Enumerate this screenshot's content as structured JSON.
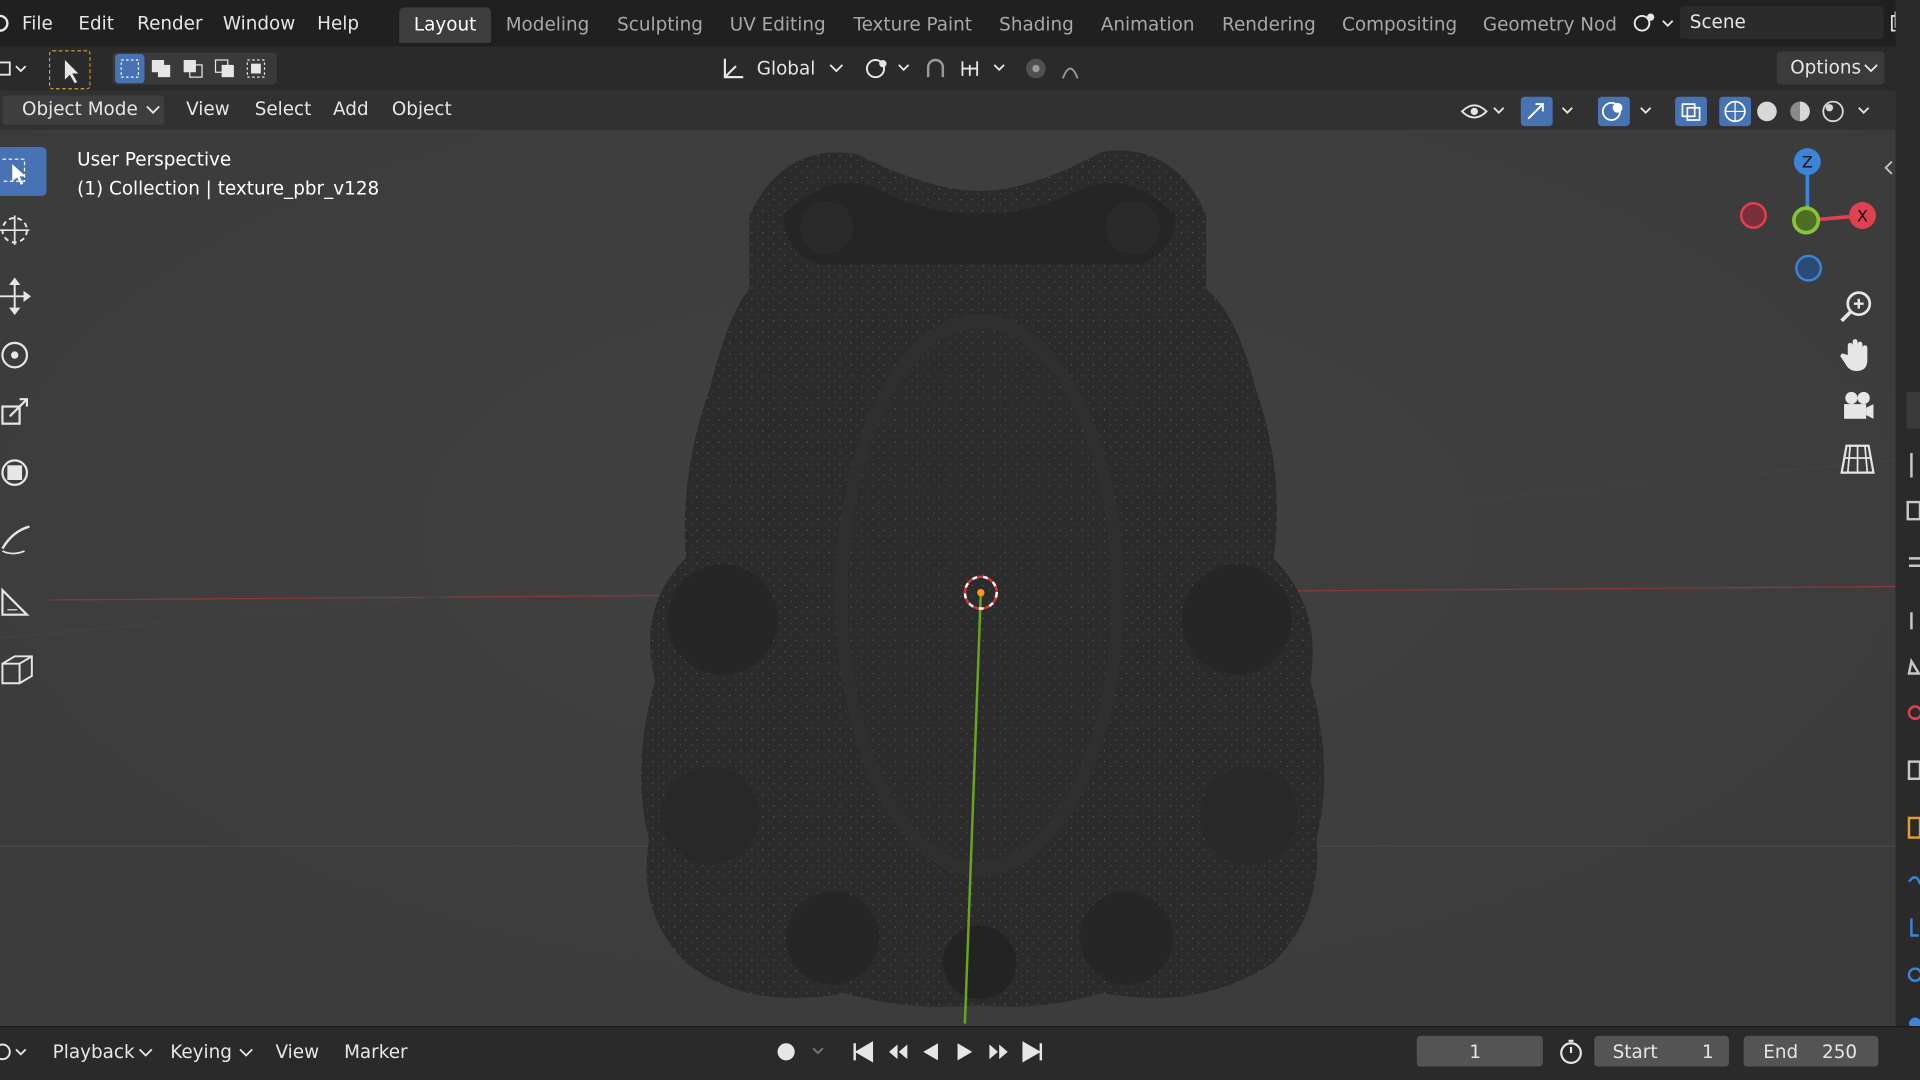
{
  "menubar": {
    "items": [
      "File",
      "Edit",
      "Render",
      "Window",
      "Help"
    ]
  },
  "workspaces": {
    "tabs": [
      "Layout",
      "Modeling",
      "Sculpting",
      "UV Editing",
      "Texture Paint",
      "Shading",
      "Animation",
      "Rendering",
      "Compositing",
      "Geometry Nod"
    ],
    "active": "Layout"
  },
  "scene": {
    "label": "Scene"
  },
  "tool_header": {
    "orientation": "Global",
    "options_label": "Options"
  },
  "viewport_header": {
    "mode": "Object Mode",
    "menus": [
      "View",
      "Select",
      "Add",
      "Object"
    ]
  },
  "viewport": {
    "perspective": "User Perspective",
    "collection": "(1) Collection | texture_pbr_v128",
    "gizmo_axes": {
      "z": "Z",
      "x": "X"
    }
  },
  "timeline": {
    "menus": [
      "Playback",
      "Keying",
      "View",
      "Marker"
    ],
    "current_frame": "1",
    "start_label": "Start",
    "start_value": "1",
    "end_label": "End",
    "end_value": "250"
  },
  "colors": {
    "accent": "#4772b3",
    "x_axis": "#e0404f",
    "y_axis": "#8ac33a",
    "z_axis": "#3b84d9"
  },
  "icons": [
    "blender-logo-icon",
    "select-box-icon",
    "cursor-icon",
    "move-icon",
    "rotate-icon",
    "scale-icon",
    "transform-icon",
    "annotate-icon",
    "measure-icon",
    "add-cube-icon",
    "zoom-icon",
    "hand-pan-icon",
    "camera-icon",
    "grid-icon",
    "play-icon",
    "record-icon"
  ]
}
